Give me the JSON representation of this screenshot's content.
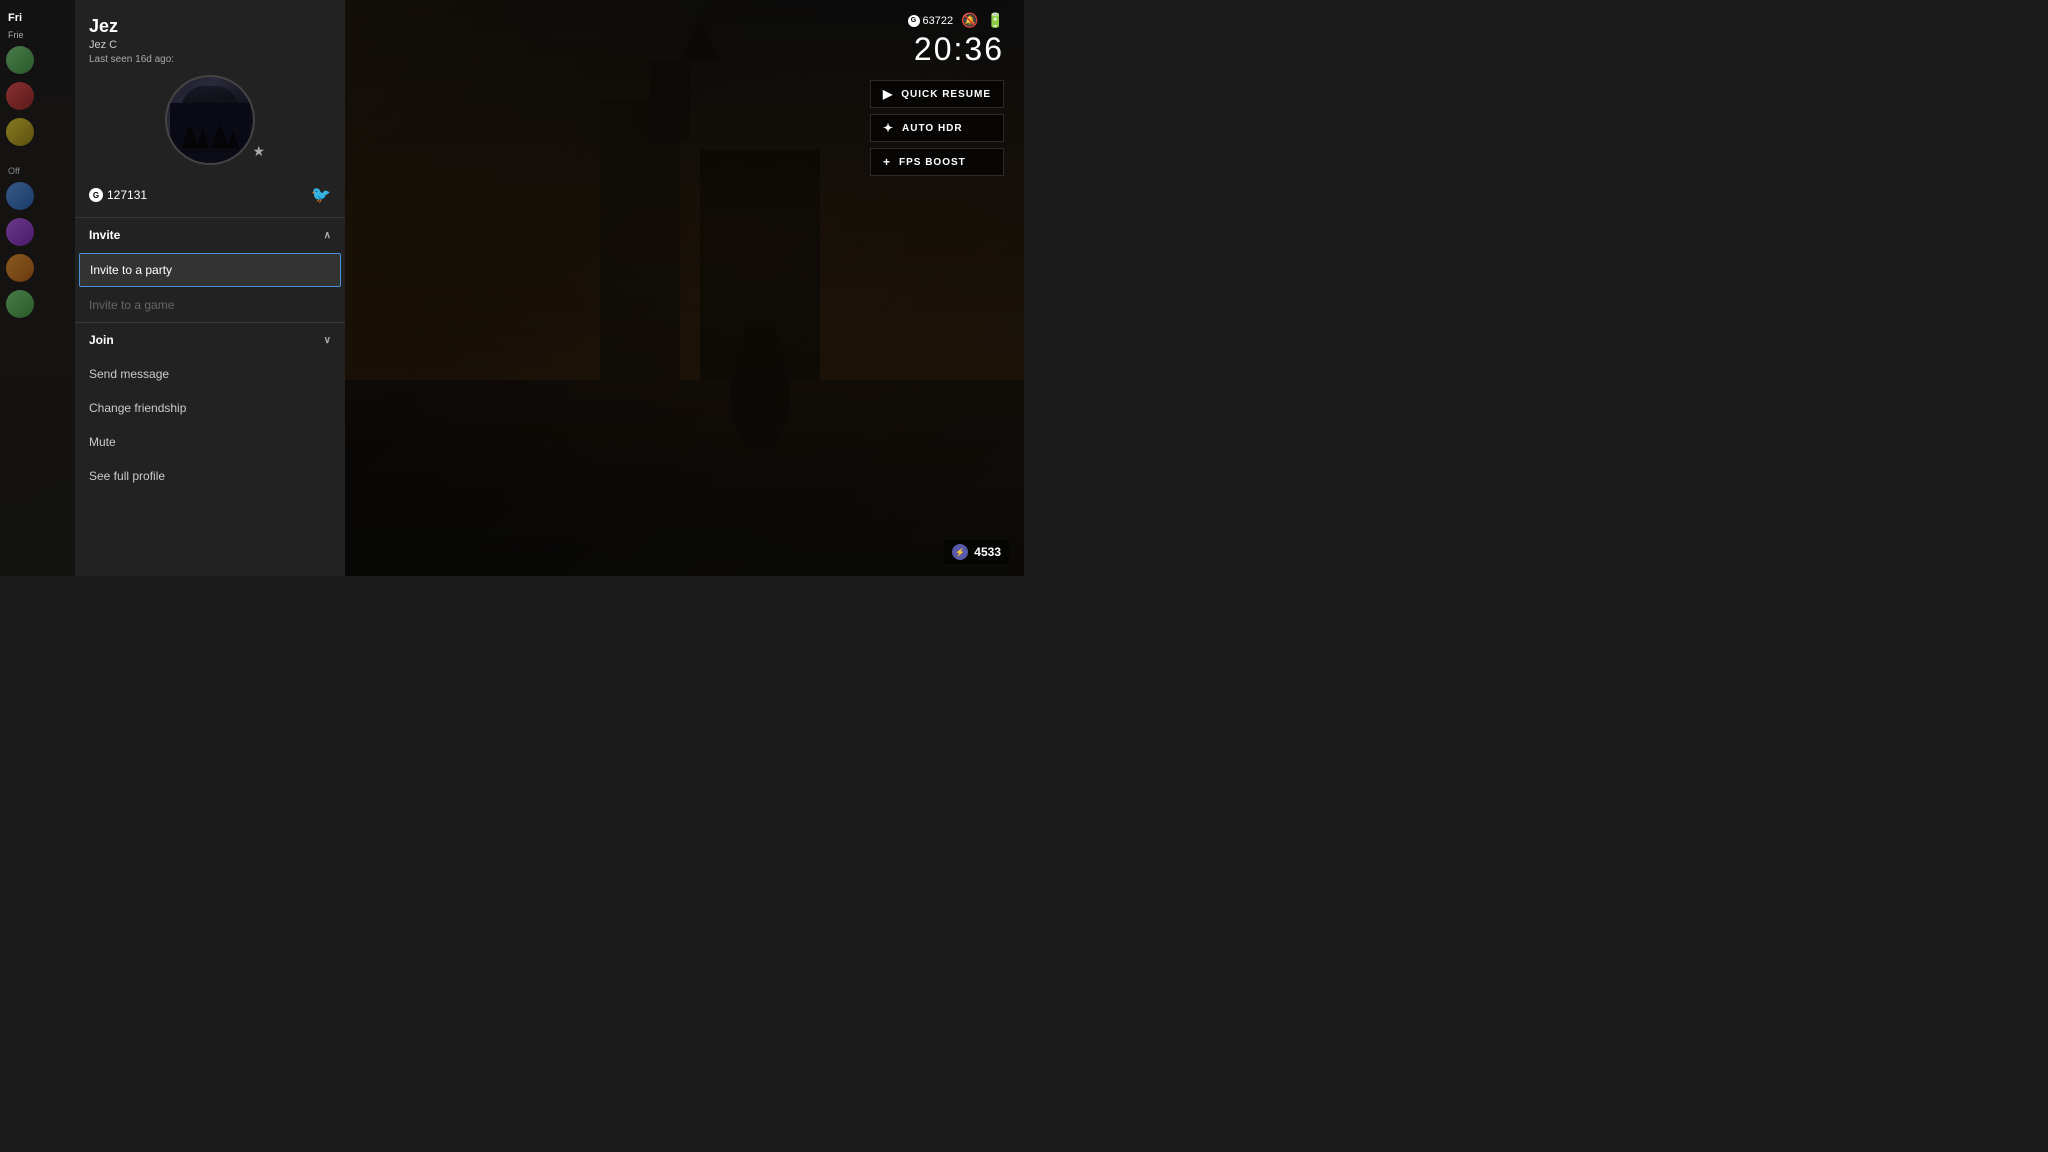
{
  "background": {
    "color": "#1a1008"
  },
  "sidebar": {
    "title": "Fri",
    "subtitle": "Frie",
    "sections": [
      {
        "label": "F",
        "status": "Off",
        "friends": []
      }
    ]
  },
  "profile": {
    "name": "Jez",
    "gamertag": "Jez C",
    "last_seen": "Last seen 16d ago:",
    "gamerscore": "127131",
    "gamerscore_prefix": "G",
    "star_icon": "★",
    "twitter_icon": "🐦"
  },
  "menu": {
    "invite_section": {
      "label": "Invite",
      "expanded": true,
      "chevron_up": "∧",
      "items": [
        {
          "label": "Invite to a party",
          "selected": true,
          "disabled": false
        },
        {
          "label": "Invite to a game",
          "selected": false,
          "disabled": true
        }
      ]
    },
    "join_section": {
      "label": "Join",
      "expanded": false,
      "chevron_down": "∨"
    },
    "standalone_items": [
      {
        "label": "Send message"
      },
      {
        "label": "Change friendship"
      },
      {
        "label": "Mute"
      },
      {
        "label": "See full profile"
      }
    ]
  },
  "hud": {
    "gamerscore": "63722",
    "time": "20:36",
    "actions": [
      {
        "icon": "▶",
        "label": "QUICK RESUME"
      },
      {
        "icon": "✦",
        "label": "AUTO HDR"
      },
      {
        "icon": "+",
        "label": "FPS BOOST"
      }
    ],
    "badge_number": "4533"
  }
}
